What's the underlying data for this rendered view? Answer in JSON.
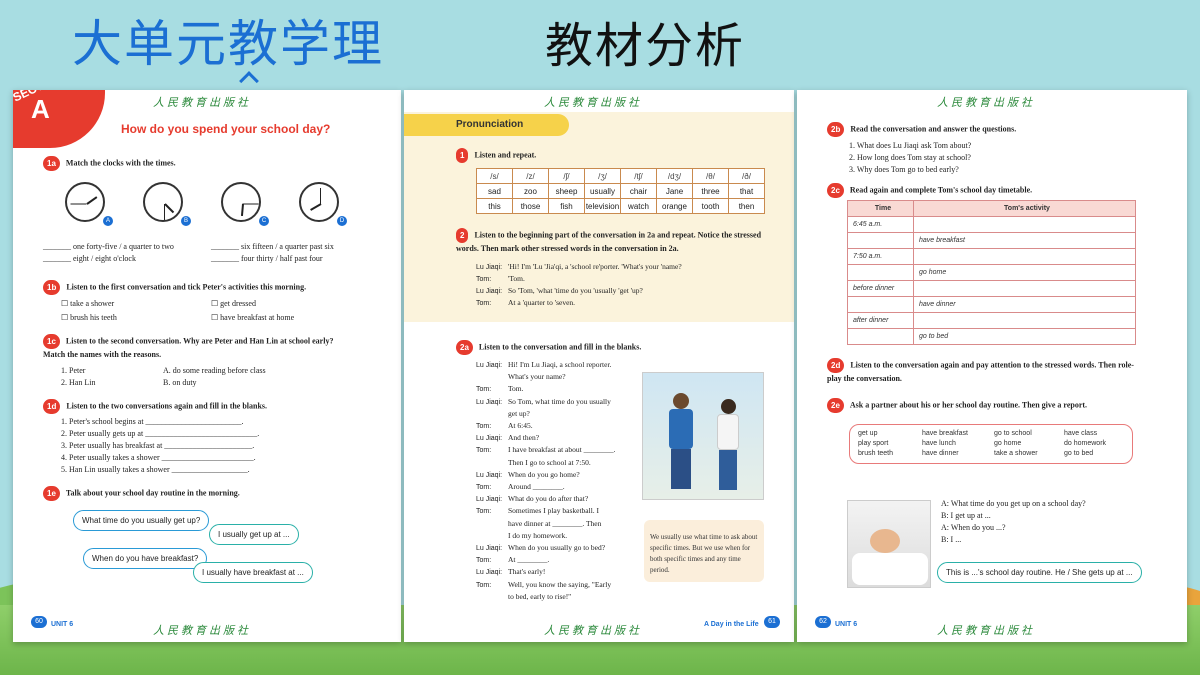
{
  "header": {
    "title_left": "大单元教学理",
    "title_right": "教材分析"
  },
  "publisher": "人民教育出版社",
  "page1": {
    "section_word": "SECTION",
    "section_letter": "A",
    "title": "How do you spend your school day?",
    "q1a": {
      "num": "1a",
      "text": "Match the clocks with the times."
    },
    "clock_labels": [
      "A",
      "B",
      "C",
      "D"
    ],
    "times": [
      "_______ one forty-five / a quarter to two",
      "_______ six fifteen / a quarter past six",
      "_______ eight / eight o'clock",
      "_______ four thirty / half past four"
    ],
    "q1b": {
      "num": "1b",
      "text": "Listen to the first conversation and tick Peter's activities this morning."
    },
    "activities": [
      "take a shower",
      "get dressed",
      "brush his teeth",
      "have breakfast at home"
    ],
    "q1c": {
      "num": "1c",
      "text": "Listen to the second conversation. Why are Peter and Han Lin at school early? Match the names with the reasons."
    },
    "names": [
      "1. Peter",
      "2. Han Lin"
    ],
    "reasons": [
      "A.  do some reading before class",
      "B.  on duty"
    ],
    "q1d": {
      "num": "1d",
      "text": "Listen to the two conversations again and fill in the blanks."
    },
    "blanks": [
      "1.  Peter's school begins at ________________________.",
      "2.  Peter usually gets up at ____________________________.",
      "3.  Peter usually has breakfast at ______________________.",
      "4.  Peter usually takes a shower _______________________.",
      "5.  Han Lin usually takes a shower ___________________."
    ],
    "q1e": {
      "num": "1e",
      "text": "Talk about your school day routine in the morning."
    },
    "bubbles": [
      "What time do you usually get up?",
      "I usually get up at ...",
      "When do you have breakfast?",
      "I usually have breakfast at ..."
    ],
    "footer_num": "60",
    "footer_unit": "UNIT 6"
  },
  "page2": {
    "pron_title": "Pronunciation",
    "q1": {
      "num": "1",
      "text": "Listen and repeat."
    },
    "pron_table": [
      [
        "/s/",
        "/z/",
        "/ʃ/",
        "/ʒ/",
        "/tʃ/",
        "/dʒ/",
        "/θ/",
        "/ð/"
      ],
      [
        "sad",
        "zoo",
        "sheep",
        "usually",
        "chair",
        "Jane",
        "three",
        "that"
      ],
      [
        "this",
        "those",
        "fish",
        "television",
        "watch",
        "orange",
        "tooth",
        "then"
      ]
    ],
    "q2": {
      "num": "2",
      "text": "Listen to the beginning part of the conversation in 2a and repeat. Notice the stressed words. Then mark other stressed words in the conversation in 2a."
    },
    "stress_lines": [
      {
        "who": "Lu Jiaqi:",
        "line": "'Hi! I'm 'Lu 'Jia'qi, a 'school re'porter. 'What's your 'name?"
      },
      {
        "who": "Tom:",
        "line": "'Tom."
      },
      {
        "who": "Lu Jiaqi:",
        "line": "So 'Tom, 'what 'time do you 'usually 'get 'up?"
      },
      {
        "who": "Tom:",
        "line": "At a 'quarter to 'seven."
      }
    ],
    "q2a": {
      "num": "2a",
      "text": "Listen to the conversation and fill in the blanks."
    },
    "dialog": [
      {
        "who": "Lu Jiaqi:",
        "line": "Hi! I'm Lu Jiaqi, a school reporter."
      },
      {
        "who": "",
        "line": "What's your name?"
      },
      {
        "who": "Tom:",
        "line": "Tom."
      },
      {
        "who": "Lu Jiaqi:",
        "line": "So Tom, what time do you usually"
      },
      {
        "who": "",
        "line": "get up?"
      },
      {
        "who": "Tom:",
        "line": "At 6:45."
      },
      {
        "who": "Lu Jiaqi:",
        "line": "And then?"
      },
      {
        "who": "Tom:",
        "line": "I have breakfast at about ________."
      },
      {
        "who": "",
        "line": "Then I go to school at 7:50."
      },
      {
        "who": "Lu Jiaqi:",
        "line": "When do you go home?"
      },
      {
        "who": "Tom:",
        "line": "Around ________."
      },
      {
        "who": "Lu Jiaqi:",
        "line": "What do you do after that?"
      },
      {
        "who": "Tom:",
        "line": "Sometimes I play basketball. I"
      },
      {
        "who": "",
        "line": "have dinner at ________. Then"
      },
      {
        "who": "",
        "line": "I do my homework."
      },
      {
        "who": "Lu Jiaqi:",
        "line": "When do you usually go to bed?"
      },
      {
        "who": "Tom:",
        "line": "At ________."
      },
      {
        "who": "Lu Jiaqi:",
        "line": "That's early!"
      },
      {
        "who": "Tom:",
        "line": "Well, you know the saying, \"Early"
      },
      {
        "who": "",
        "line": "to bed, early to rise!\""
      }
    ],
    "note": "We usually use what time to ask about specific times. But we use when for both specific times and any time period.",
    "footer_txt": "A Day in the Life",
    "footer_num": "61"
  },
  "page3": {
    "q2b": {
      "num": "2b",
      "text": "Read the conversation and answer the questions."
    },
    "questions": [
      "1.  What does Lu Jiaqi ask Tom about?",
      "2.  How long does Tom stay at school?",
      "3.  Why does Tom go to bed early?"
    ],
    "q2c": {
      "num": "2c",
      "text": "Read again and complete Tom's school day timetable."
    },
    "tt_head": [
      "Time",
      "Tom's activity"
    ],
    "tt_rows": [
      [
        "6:45 a.m.",
        ""
      ],
      [
        "",
        "have breakfast"
      ],
      [
        "7:50 a.m.",
        ""
      ],
      [
        "",
        "go home"
      ],
      [
        "before dinner",
        ""
      ],
      [
        "",
        "have dinner"
      ],
      [
        "after dinner",
        ""
      ],
      [
        "",
        "go to bed"
      ]
    ],
    "q2d": {
      "num": "2d",
      "text": "Listen to the conversation again and pay attention to the stressed words. Then role-play the conversation."
    },
    "q2e": {
      "num": "2e",
      "text": "Ask a partner about his or her school day routine. Then give a report."
    },
    "phrases": [
      "get up",
      "have breakfast",
      "go to school",
      "have class",
      "play sport",
      "have lunch",
      "go home",
      "do homework",
      "brush teeth",
      "have dinner",
      "take a shower",
      "go to bed"
    ],
    "ab_lines": [
      "A:  What time do you get up on a school day?",
      "B:  I get up at ...",
      "A:  When do you ...?",
      "B:  I ..."
    ],
    "report": "This is ...'s school day routine. He / She gets up at ...",
    "footer_num": "62",
    "footer_unit": "UNIT 6"
  }
}
